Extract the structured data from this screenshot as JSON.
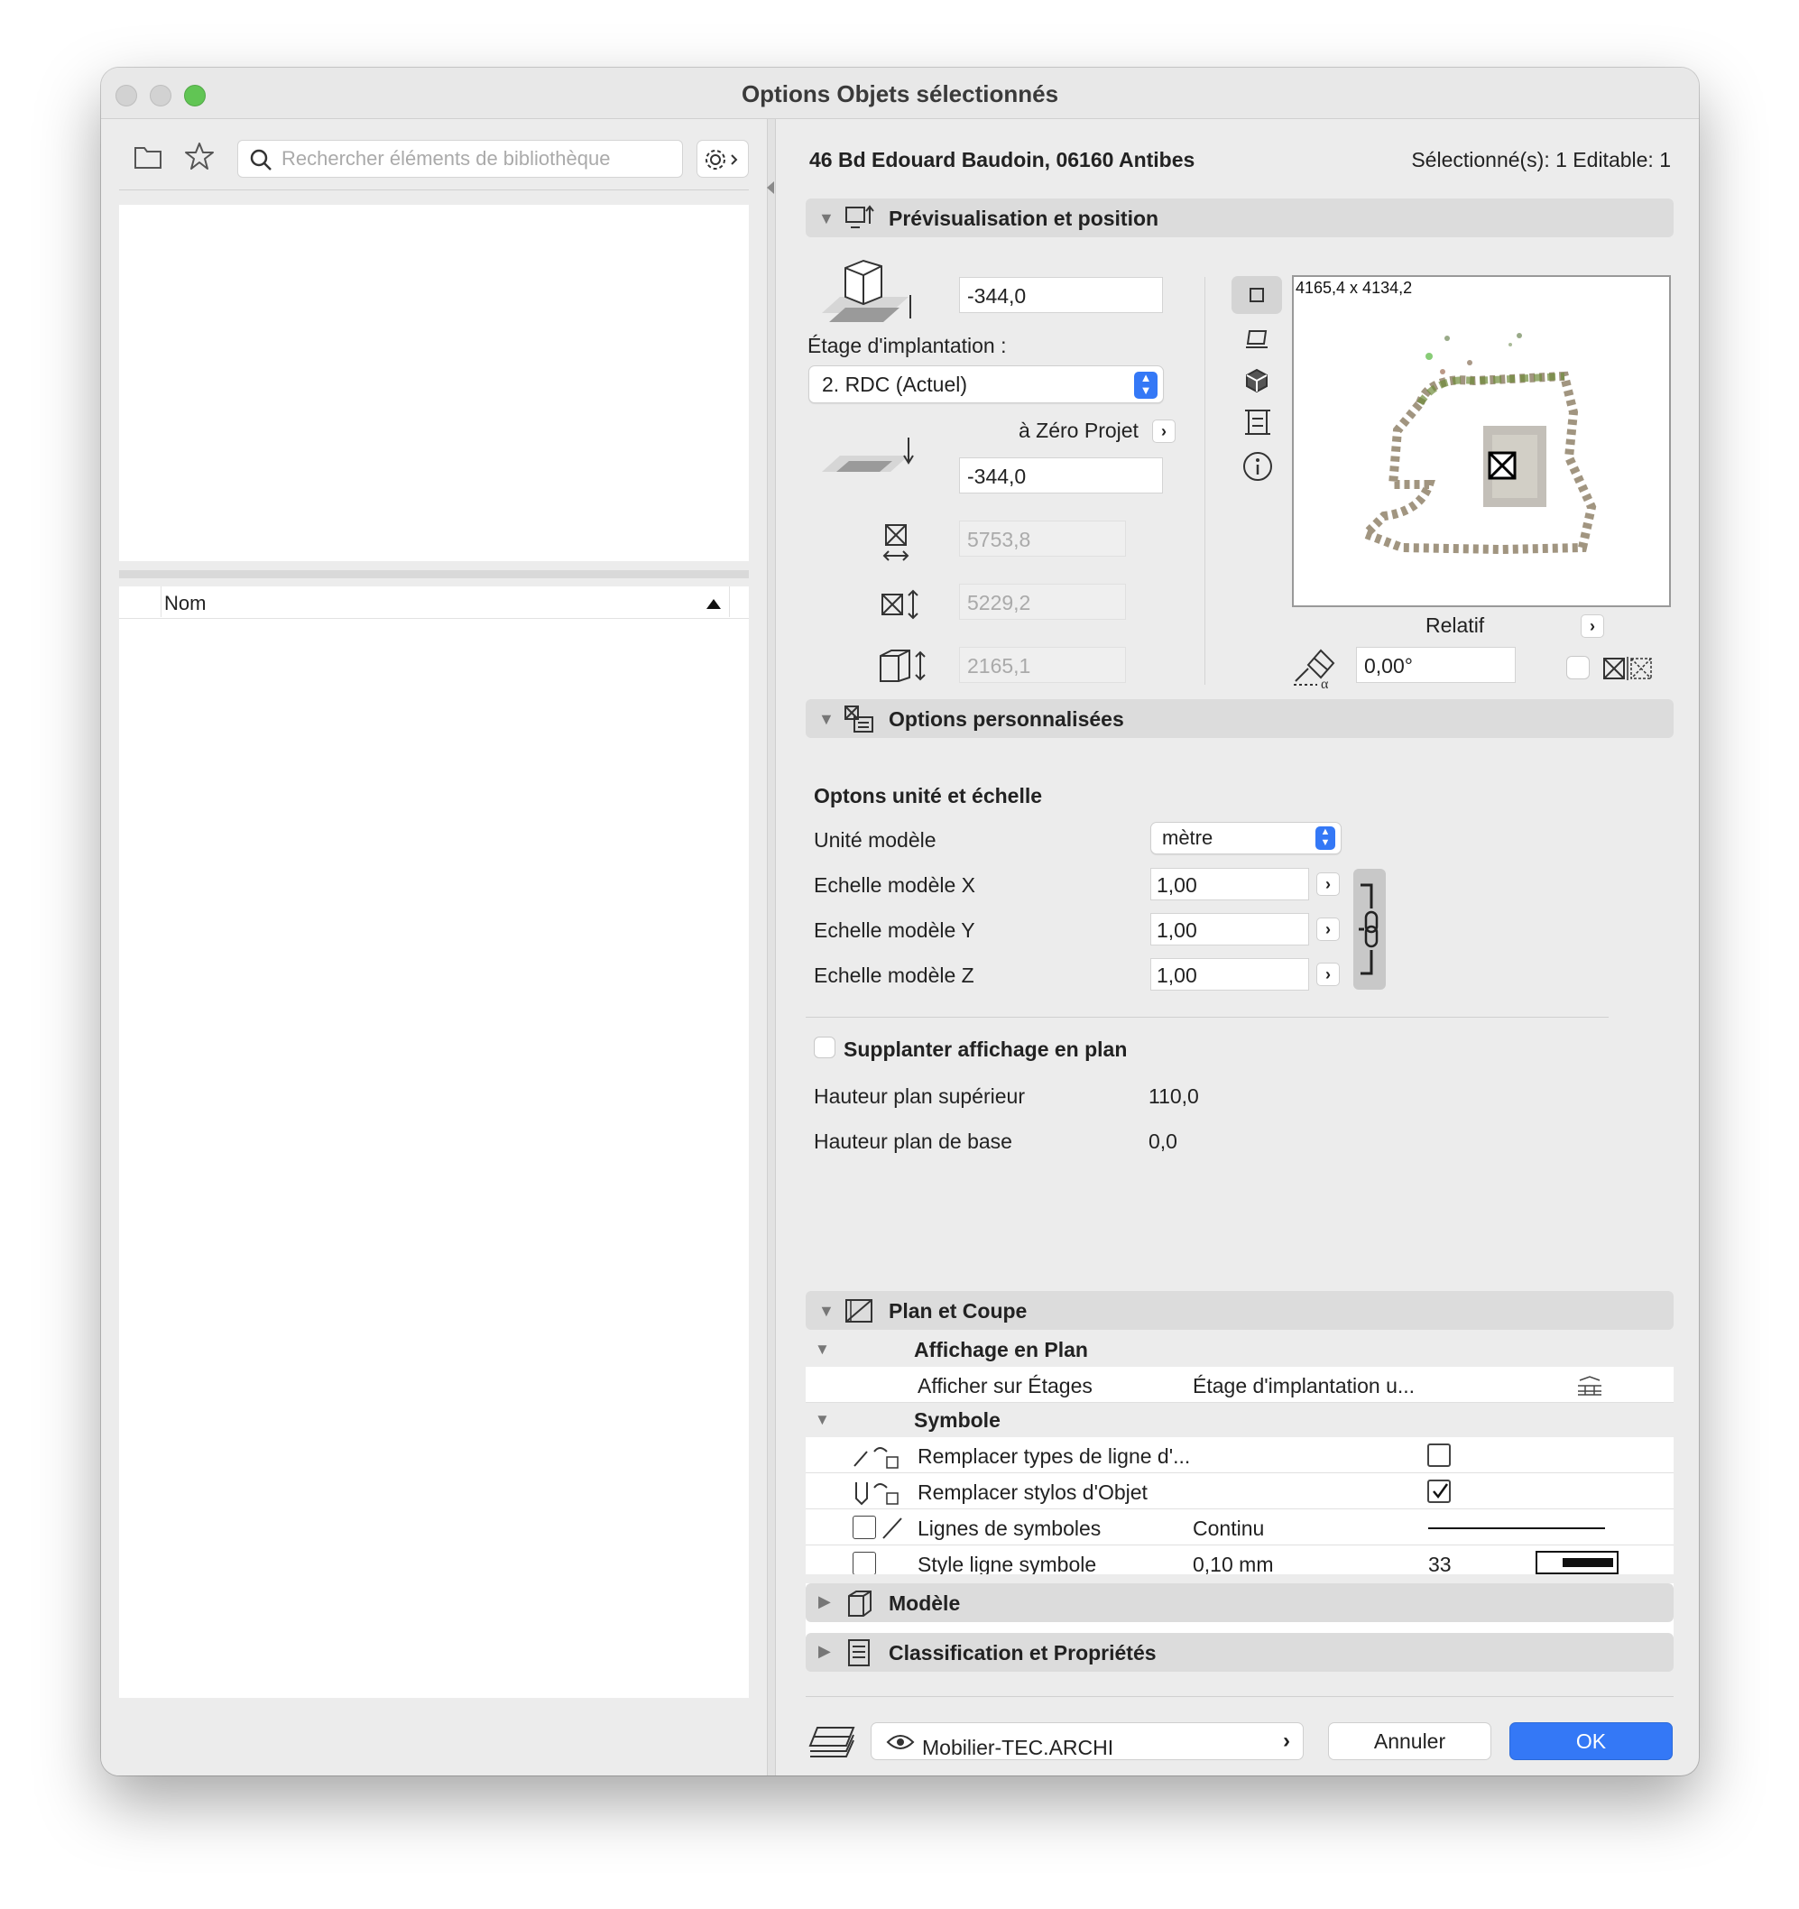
{
  "window": {
    "title": "Options Objets sélectionnés",
    "traffic_colors": [
      "#d0d0d0",
      "#d0d0d0",
      "#61c554"
    ]
  },
  "library": {
    "search_placeholder": "Rechercher éléments de bibliothèque",
    "column_header": "Nom"
  },
  "header": {
    "project": "46 Bd Edouard Baudoin, 06160 Antibes",
    "selection": "Sélectionné(s): 1 Editable: 1"
  },
  "preview": {
    "section_label": "Prévisualisation et position",
    "elevation_value": "-344,0",
    "story_label": "Étage d'implantation :",
    "story_value": "2. RDC (Actuel)",
    "zero_label": "à Zéro Projet",
    "zero_value": "-344,0",
    "width_value": "5753,8",
    "depth_value": "5229,2",
    "height_value": "2165,1",
    "dims_caption": "4165,4 x 4134,2",
    "relative_label": "Relatif",
    "angle_value": "0,00°"
  },
  "custom": {
    "section_label": "Options personnalisées",
    "subheading": "Optons unité et échelle",
    "unit_label": "Unité modèle",
    "unit_value": "mètre",
    "scale_x_label": "Echelle modèle X",
    "scale_x_value": "1,00",
    "scale_y_label": "Echelle modèle Y",
    "scale_y_value": "1,00",
    "scale_z_label": "Echelle modèle Z",
    "scale_z_value": "1,00",
    "override_label": "Supplanter affichage en plan",
    "upper_label": "Hauteur plan supérieur",
    "upper_value": "110,0",
    "base_label": "Hauteur plan de base",
    "base_value": "0,0"
  },
  "plan": {
    "section_label": "Plan et Coupe",
    "display_group": "Affichage en Plan",
    "show_on_label": "Afficher sur Étages",
    "show_on_value": "Étage d'implantation u...",
    "symbol_group": "Symbole",
    "replace_lines_label": "Remplacer types de ligne d'...",
    "replace_pens_label": "Remplacer stylos d'Objet",
    "symbol_lines_label": "Lignes de symboles",
    "symbol_lines_value": "Continu",
    "partial_row_label": "Style ligne symbole",
    "partial_row_value": "0,10 mm",
    "partial_row_pen": "33"
  },
  "model": {
    "section_label": "Modèle"
  },
  "classification": {
    "section_label": "Classification et Propriétés"
  },
  "footer": {
    "layer_value": "Mobilier-TEC.ARCHI",
    "cancel_label": "Annuler",
    "ok_label": "OK"
  },
  "colors": {
    "accent": "#3478f6",
    "window_bg": "#ececec",
    "section_bg": "#dcdcdc"
  }
}
